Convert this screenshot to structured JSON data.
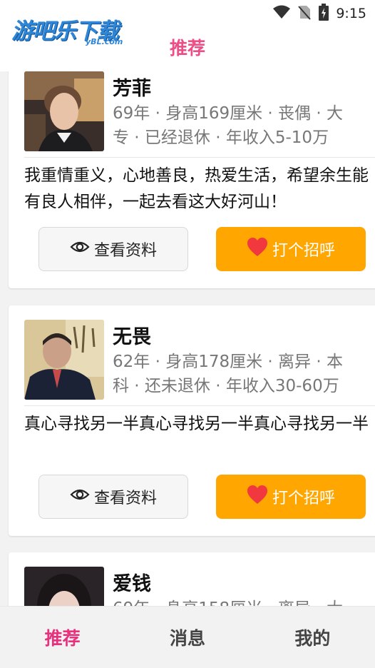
{
  "status_bar": {
    "time": "9:15",
    "icons": [
      "wifi-icon",
      "no-sim-icon",
      "battery-charging-icon"
    ]
  },
  "header": {
    "logo_main": "游吧乐下载",
    "logo_sub": "yBL.com",
    "title": "推荐"
  },
  "cards": [
    {
      "name": "芳菲",
      "meta": "69年 · 身高169厘米 · 丧偶 · 大专 · 已经退休 · 年收入5-10万",
      "intro": "我重情重义，心地善良，热爱生活，希望余生能有良人相伴，一起去看这大好河山！",
      "view_label": "查看资料",
      "greet_label": "打个招呼"
    },
    {
      "name": "无畏",
      "meta": "62年 · 身高178厘米 · 离异 · 本科 · 还未退休 · 年收入30-60万",
      "intro": "真心寻找另一半真心寻找另一半真心寻找另一半",
      "view_label": "查看资料",
      "greet_label": "打个招呼"
    },
    {
      "name": "爱钱",
      "meta": "69年 · 身高158厘米 · 离异 · 大",
      "intro": "",
      "view_label": "",
      "greet_label": ""
    }
  ],
  "bottom_nav": {
    "items": [
      "推荐",
      "消息",
      "我的"
    ],
    "active": "推荐"
  },
  "colors": {
    "accent": "#e8317d",
    "greet_button": "#ffa600",
    "header_title": "#ec4f86",
    "logo": "#2f86d6"
  }
}
